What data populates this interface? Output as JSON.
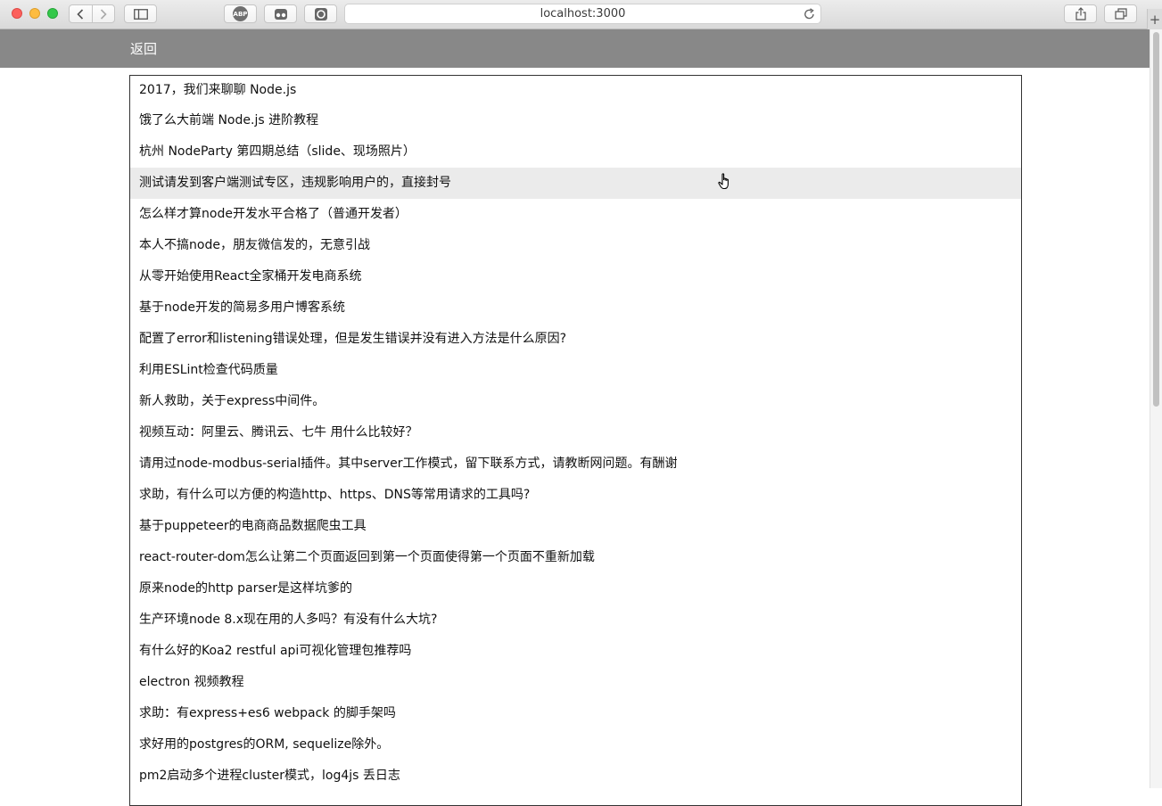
{
  "browser": {
    "url": "localhost:3000",
    "icons": {
      "back": "chevron-left-icon",
      "forward": "chevron-right-icon",
      "sidebar": "sidebar-icon",
      "adblock": "adblock-plus-icon",
      "reader": "glasses-icon",
      "extension": "circle-extension-icon",
      "reload": "reload-icon",
      "share": "share-icon",
      "tabs": "tabs-overview-icon",
      "new_tab": "plus-icon"
    },
    "adblock_label": "ABP",
    "new_tab_label": "+"
  },
  "header": {
    "back_label": "返回",
    "background": "#888888"
  },
  "topics": [
    "2017，我们来聊聊 Node.js",
    "饿了么大前端 Node.js 进阶教程",
    "杭州 NodeParty 第四期总结（slide、现场照片）",
    "测试请发到客户端测试专区，违规影响用户的，直接封号",
    "怎么样才算node开发水平合格了（普通开发者）",
    "本人不搞node，朋友微信发的，无意引战",
    "从零开始使用React全家桶开发电商系统",
    "基于node开发的简易多用户博客系统",
    "配置了error和listening错误处理，但是发生错误并没有进入方法是什么原因?",
    "利用ESLint检查代码质量",
    "新人救助，关于express中间件。",
    "视频互动：阿里云、腾讯云、七牛 用什么比较好？",
    "请用过node-modbus-serial插件。其中server工作模式，留下联系方式，请教断网问题。有酬谢",
    "求助，有什么可以方便的构造http、https、DNS等常用请求的工具吗?",
    "基于puppeteer的电商商品数据爬虫工具",
    "react-router-dom怎么让第二个页面返回到第一个页面使得第一个页面不重新加载",
    "原来node的http parser是这样坑爹的",
    "生产环境node 8.x现在用的人多吗？有没有什么大坑?",
    "有什么好的Koa2 restful api可视化管理包推荐吗",
    "electron 视频教程",
    "求助：有express+es6 webpack 的脚手架吗",
    "求好用的postgres的ORM, sequelize除外。",
    "pm2启动多个进程cluster模式，log4js 丢日志"
  ],
  "hovered_index": 3,
  "cursor_icon": "pointer-hand-icon"
}
